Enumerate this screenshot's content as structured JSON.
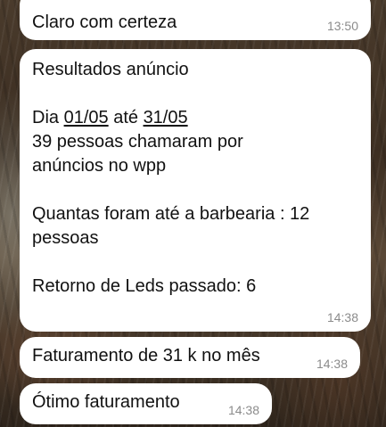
{
  "messages": [
    {
      "text": "Claro com certeza",
      "time": "13:50"
    },
    {
      "line1": "Resultados anúncio",
      "date_prefix": "Dia ",
      "date_from": "01/05",
      "date_mid": " até ",
      "date_to": "31/05",
      "line3": "39 pessoas chamaram por\nanúncios no wpp",
      "line4": "Quantas foram até a barbearia :  12\npessoas",
      "line5": "Retorno de Leds passado: 6",
      "time": "14:38"
    },
    {
      "text": "Faturamento de 31 k no mês",
      "time": "14:38"
    },
    {
      "text": "Ótimo faturamento",
      "time": "14:38"
    }
  ]
}
